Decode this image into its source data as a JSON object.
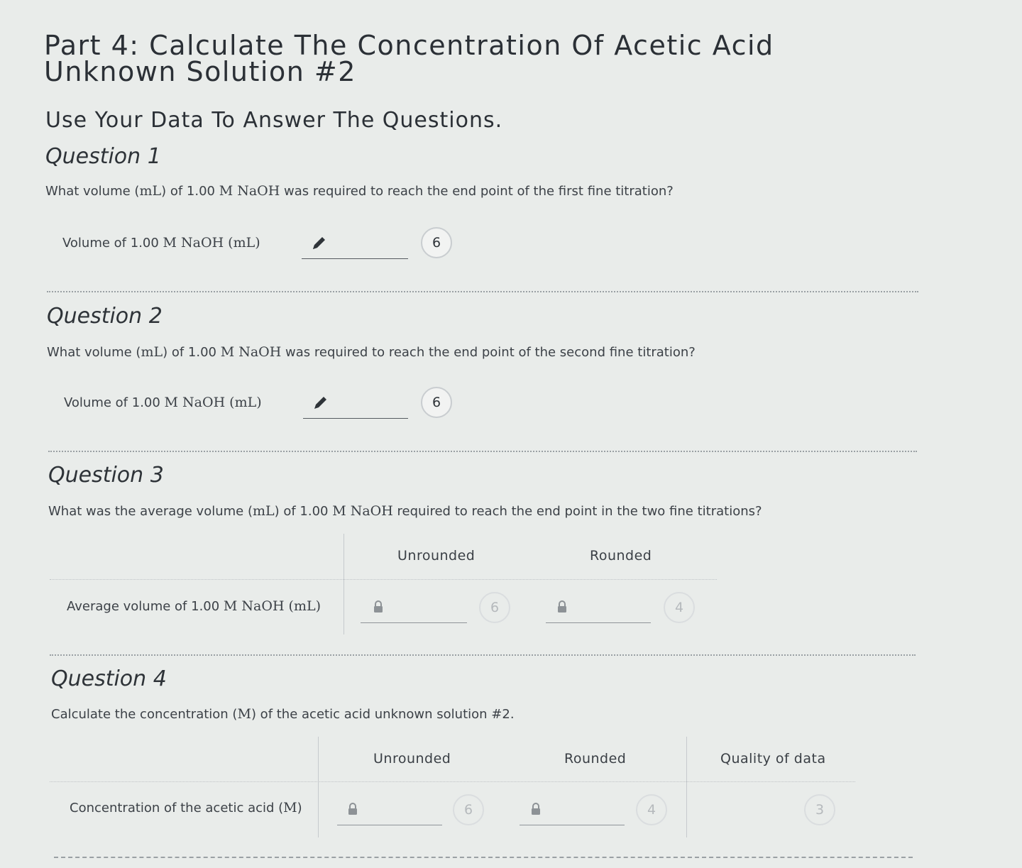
{
  "header": {
    "title_line1": "Part 4: Calculate The Concentration Of Acetic Acid",
    "title_line2": "Unknown Solution #2",
    "subtitle": "Use Your Data To Answer The Questions."
  },
  "q1": {
    "title": "Question 1",
    "text_pre": "What volume (",
    "text_unit": "mL",
    "text_mid": ") of 1.00 ",
    "text_chem": "M NaOH",
    "text_post": " was required to reach the end point of the first fine titration?",
    "label_pre": "Volume of 1.00 ",
    "label_chem": "M NaOH (mL)",
    "input_value": "",
    "badge": "6"
  },
  "q2": {
    "title": "Question 2",
    "text_pre": "What volume (",
    "text_unit": "mL",
    "text_mid": ") of 1.00 ",
    "text_chem": "M NaOH",
    "text_post": " was required to reach the end point of the second fine titration?",
    "label_pre": "Volume of 1.00 ",
    "label_chem": "M NaOH (mL)",
    "input_value": "",
    "badge": "6"
  },
  "q3": {
    "title": "Question 3",
    "text_pre": "What was the average volume (",
    "text_unit": "mL",
    "text_mid": ") of 1.00 ",
    "text_chem": "M NaOH",
    "text_post": " required to reach the end point in the two fine titrations?",
    "col_unrounded": "Unrounded",
    "col_rounded": "Rounded",
    "row_label_pre": "Average volume of 1.00 ",
    "row_label_chem": "M NaOH (mL)",
    "badge_unrounded": "6",
    "badge_rounded": "4"
  },
  "q4": {
    "title": "Question 4",
    "text_pre": "Calculate the concentration (",
    "text_unit": "M",
    "text_post": ") of the acetic acid unknown solution #2.",
    "col_unrounded": "Unrounded",
    "col_rounded": "Rounded",
    "col_quality": "Quality of data",
    "row_label_pre": "Concentration of the acetic acid (",
    "row_label_unit": "M",
    "row_label_post": ")",
    "badge_unrounded": "6",
    "badge_rounded": "4",
    "badge_quality": "3"
  },
  "icons": {
    "pencil": "pencil-icon",
    "lock": "lock-icon"
  },
  "colors": {
    "background": "#e9ecea",
    "text": "#3a3f45",
    "badge_border": "#c9cdd0"
  }
}
